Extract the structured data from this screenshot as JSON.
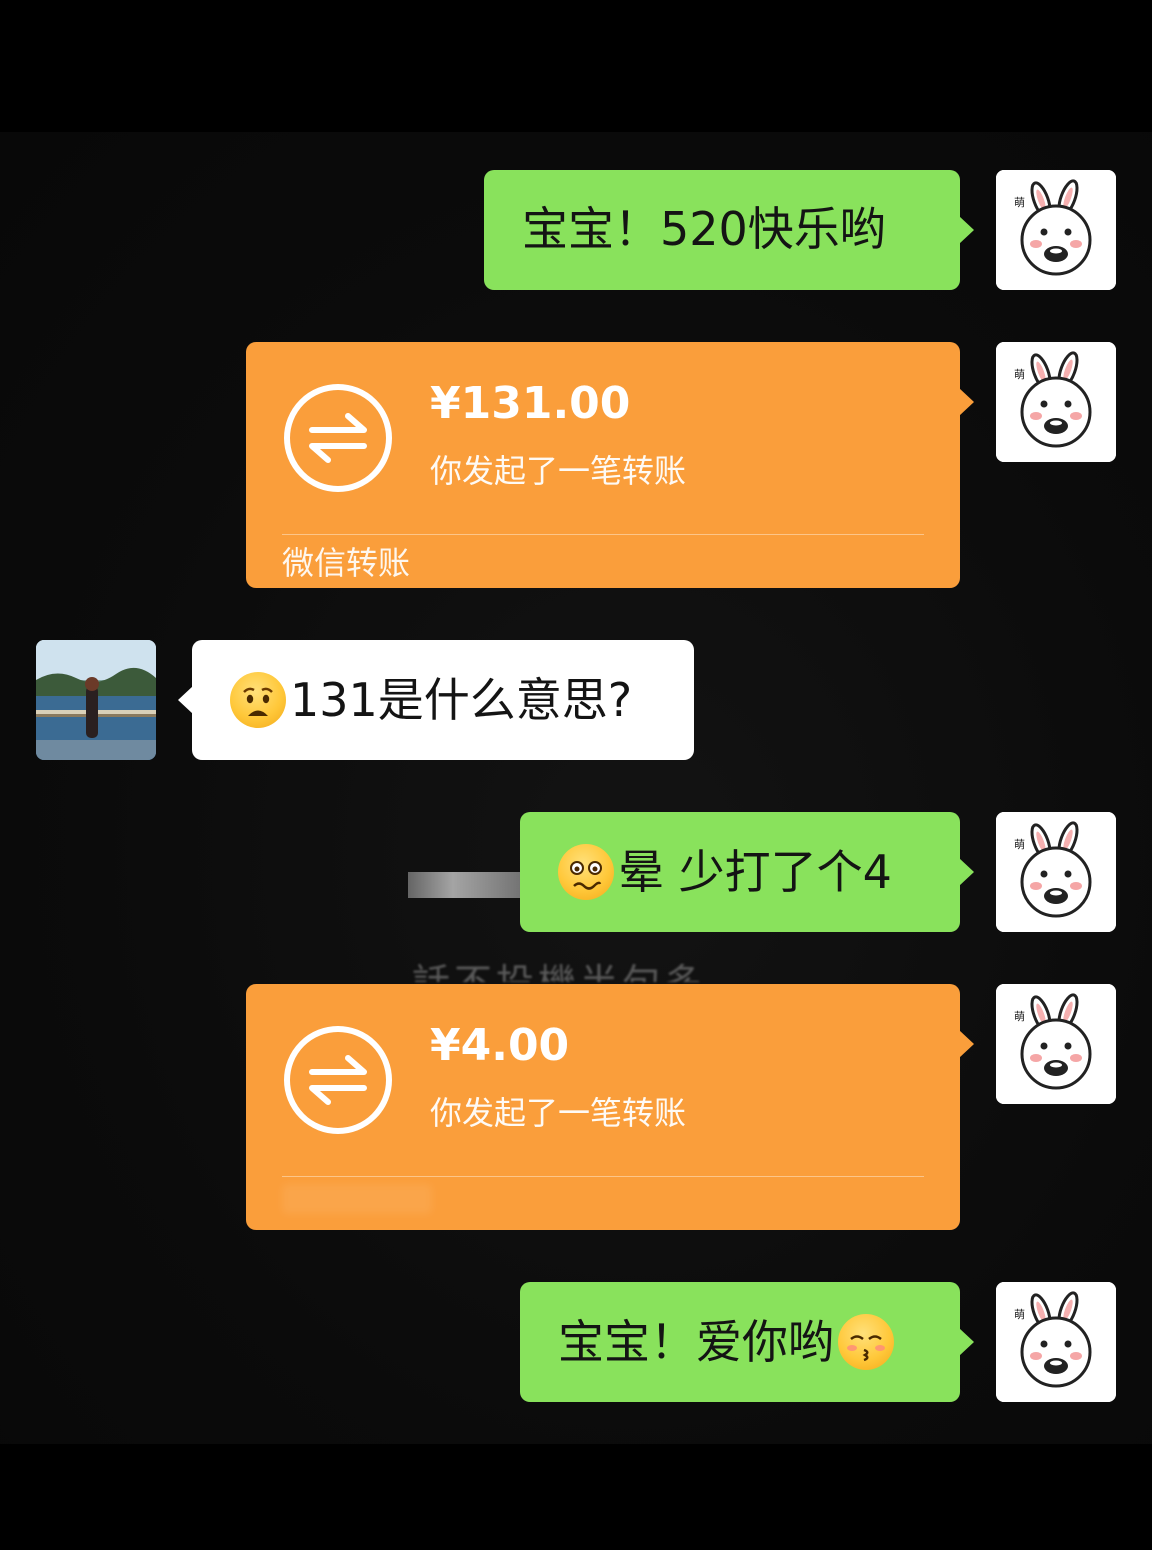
{
  "messages": [
    {
      "id": "m1",
      "side": "right",
      "type": "text",
      "text": "宝宝！520快乐哟"
    },
    {
      "id": "m2",
      "side": "right",
      "type": "transfer",
      "amount": "¥131.00",
      "subtitle": "你发起了一笔转账",
      "footer": "微信转账"
    },
    {
      "id": "m3",
      "side": "left",
      "type": "text",
      "emoji": "anxious-face",
      "text": "131是什么意思?"
    },
    {
      "id": "m4",
      "side": "right",
      "type": "text",
      "emoji": "woozy-face",
      "text": "晕 少打了个4"
    },
    {
      "id": "m5",
      "side": "right",
      "type": "transfer",
      "amount": "¥4.00",
      "subtitle": "你发起了一笔转账",
      "footer": ""
    },
    {
      "id": "m6",
      "side": "right",
      "type": "text",
      "text": "宝宝！爱你哟",
      "emoji": "kissing-face"
    }
  ],
  "watermark": "話不投機半句多",
  "colors": {
    "sent_bubble": "#89e25c",
    "received_bubble": "#ffffff",
    "transfer_card": "#fa9e3b",
    "background": "#000000"
  }
}
